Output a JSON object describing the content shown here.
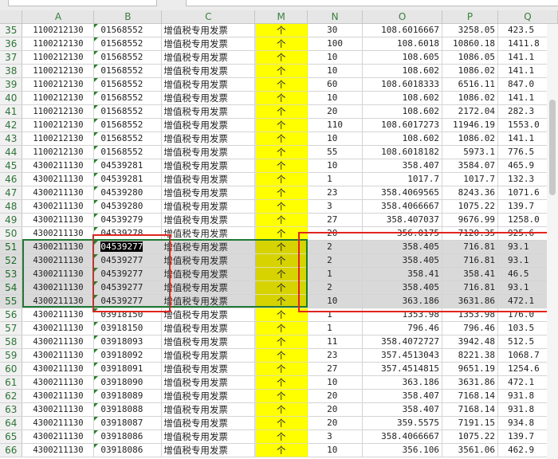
{
  "columns": [
    "A",
    "B",
    "C",
    "M",
    "N",
    "O",
    "P",
    "Q"
  ],
  "rows": [
    {
      "n": "35",
      "a": "1100212130",
      "b": "01568552",
      "c": "增值税专用发票",
      "m": "个",
      "nq": "30",
      "o": "108.6016667",
      "p": "3258.05",
      "q": "423.5"
    },
    {
      "n": "36",
      "a": "1100212130",
      "b": "01568552",
      "c": "增值税专用发票",
      "m": "个",
      "nq": "100",
      "o": "108.6018",
      "p": "10860.18",
      "q": "1411.8"
    },
    {
      "n": "37",
      "a": "1100212130",
      "b": "01568552",
      "c": "增值税专用发票",
      "m": "个",
      "nq": "10",
      "o": "108.605",
      "p": "1086.05",
      "q": "141.1"
    },
    {
      "n": "38",
      "a": "1100212130",
      "b": "01568552",
      "c": "增值税专用发票",
      "m": "个",
      "nq": "10",
      "o": "108.602",
      "p": "1086.02",
      "q": "141.1"
    },
    {
      "n": "39",
      "a": "1100212130",
      "b": "01568552",
      "c": "增值税专用发票",
      "m": "个",
      "nq": "60",
      "o": "108.6018333",
      "p": "6516.11",
      "q": "847.0"
    },
    {
      "n": "40",
      "a": "1100212130",
      "b": "01568552",
      "c": "增值税专用发票",
      "m": "个",
      "nq": "10",
      "o": "108.602",
      "p": "1086.02",
      "q": "141.1"
    },
    {
      "n": "41",
      "a": "1100212130",
      "b": "01568552",
      "c": "增值税专用发票",
      "m": "个",
      "nq": "20",
      "o": "108.602",
      "p": "2172.04",
      "q": "282.3"
    },
    {
      "n": "42",
      "a": "1100212130",
      "b": "01568552",
      "c": "增值税专用发票",
      "m": "个",
      "nq": "110",
      "o": "108.6017273",
      "p": "11946.19",
      "q": "1553.0"
    },
    {
      "n": "43",
      "a": "1100212130",
      "b": "01568552",
      "c": "增值税专用发票",
      "m": "个",
      "nq": "10",
      "o": "108.602",
      "p": "1086.02",
      "q": "141.1"
    },
    {
      "n": "44",
      "a": "1100212130",
      "b": "01568552",
      "c": "增值税专用发票",
      "m": "个",
      "nq": "55",
      "o": "108.6018182",
      "p": "5973.1",
      "q": "776.5"
    },
    {
      "n": "45",
      "a": "4300211130",
      "b": "04539281",
      "c": "增值税专用发票",
      "m": "个",
      "nq": "10",
      "o": "358.407",
      "p": "3584.07",
      "q": "465.9"
    },
    {
      "n": "46",
      "a": "4300211130",
      "b": "04539281",
      "c": "增值税专用发票",
      "m": "个",
      "nq": "1",
      "o": "1017.7",
      "p": "1017.7",
      "q": "132.3"
    },
    {
      "n": "47",
      "a": "4300211130",
      "b": "04539280",
      "c": "增值税专用发票",
      "m": "个",
      "nq": "23",
      "o": "358.4069565",
      "p": "8243.36",
      "q": "1071.6"
    },
    {
      "n": "48",
      "a": "4300211130",
      "b": "04539280",
      "c": "增值税专用发票",
      "m": "个",
      "nq": "3",
      "o": "358.4066667",
      "p": "1075.22",
      "q": "139.7"
    },
    {
      "n": "49",
      "a": "4300211130",
      "b": "04539279",
      "c": "增值税专用发票",
      "m": "个",
      "nq": "27",
      "o": "358.407037",
      "p": "9676.99",
      "q": "1258.0"
    },
    {
      "n": "50",
      "a": "4300211130",
      "b": "04539278",
      "c": "增值税专用发票",
      "m": "个",
      "nq": "20",
      "o": "356.0175",
      "p": "7120.35",
      "q": "925.6"
    },
    {
      "n": "51",
      "a": "4300211130",
      "b": "04539277",
      "c": "增值税专用发票",
      "m": "个",
      "nq": "2",
      "o": "358.405",
      "p": "716.81",
      "q": "93.1"
    },
    {
      "n": "52",
      "a": "4300211130",
      "b": "04539277",
      "c": "增值税专用发票",
      "m": "个",
      "nq": "2",
      "o": "358.405",
      "p": "716.81",
      "q": "93.1"
    },
    {
      "n": "53",
      "a": "4300211130",
      "b": "04539277",
      "c": "增值税专用发票",
      "m": "个",
      "nq": "1",
      "o": "358.41",
      "p": "358.41",
      "q": "46.5"
    },
    {
      "n": "54",
      "a": "4300211130",
      "b": "04539277",
      "c": "增值税专用发票",
      "m": "个",
      "nq": "2",
      "o": "358.405",
      "p": "716.81",
      "q": "93.1"
    },
    {
      "n": "55",
      "a": "4300211130",
      "b": "04539277",
      "c": "增值税专用发票",
      "m": "个",
      "nq": "10",
      "o": "363.186",
      "p": "3631.86",
      "q": "472.1"
    },
    {
      "n": "56",
      "a": "4300211130",
      "b": "03918150",
      "c": "增值税专用发票",
      "m": "个",
      "nq": "1",
      "o": "1353.98",
      "p": "1353.98",
      "q": "176.0"
    },
    {
      "n": "57",
      "a": "4300211130",
      "b": "03918150",
      "c": "增值税专用发票",
      "m": "个",
      "nq": "1",
      "o": "796.46",
      "p": "796.46",
      "q": "103.5"
    },
    {
      "n": "58",
      "a": "4300211130",
      "b": "03918093",
      "c": "增值税专用发票",
      "m": "个",
      "nq": "11",
      "o": "358.4072727",
      "p": "3942.48",
      "q": "512.5"
    },
    {
      "n": "59",
      "a": "4300211130",
      "b": "03918092",
      "c": "增值税专用发票",
      "m": "个",
      "nq": "23",
      "o": "357.4513043",
      "p": "8221.38",
      "q": "1068.7"
    },
    {
      "n": "60",
      "a": "4300211130",
      "b": "03918091",
      "c": "增值税专用发票",
      "m": "个",
      "nq": "27",
      "o": "357.4514815",
      "p": "9651.19",
      "q": "1254.6"
    },
    {
      "n": "61",
      "a": "4300211130",
      "b": "03918090",
      "c": "增值税专用发票",
      "m": "个",
      "nq": "10",
      "o": "363.186",
      "p": "3631.86",
      "q": "472.1"
    },
    {
      "n": "62",
      "a": "4300211130",
      "b": "03918089",
      "c": "增值税专用发票",
      "m": "个",
      "nq": "20",
      "o": "358.407",
      "p": "7168.14",
      "q": "931.8"
    },
    {
      "n": "63",
      "a": "4300211130",
      "b": "03918088",
      "c": "增值税专用发票",
      "m": "个",
      "nq": "20",
      "o": "358.407",
      "p": "7168.14",
      "q": "931.8"
    },
    {
      "n": "64",
      "a": "4300211130",
      "b": "03918087",
      "c": "增值税专用发票",
      "m": "个",
      "nq": "20",
      "o": "359.5575",
      "p": "7191.15",
      "q": "934.8"
    },
    {
      "n": "65",
      "a": "4300211130",
      "b": "03918086",
      "c": "增值税专用发票",
      "m": "个",
      "nq": "3",
      "o": "358.4066667",
      "p": "1075.22",
      "q": "139.7"
    },
    {
      "n": "66",
      "a": "4300211130",
      "b": "03918086",
      "c": "增值税专用发票",
      "m": "个",
      "nq": "10",
      "o": "356.106",
      "p": "3561.06",
      "q": "462.9"
    }
  ],
  "selection": {
    "first_row": "51",
    "last_row": "55",
    "active_cell": "B51"
  },
  "colors": {
    "highlight_column": "#ffff00",
    "red_box": "#e0261f",
    "green_box": "#1f7a34"
  }
}
